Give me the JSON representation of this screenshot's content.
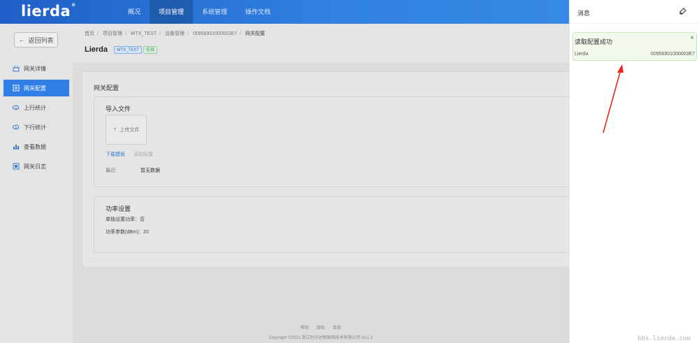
{
  "app": {
    "logo": "lierda"
  },
  "topnav": [
    "概况",
    "项目管理",
    "系统管理",
    "操作文档"
  ],
  "sidebar": {
    "back_label": "返回列表",
    "items": [
      {
        "label": "网关详情",
        "icon": "gateway-detail-icon"
      },
      {
        "label": "网关配置",
        "icon": "gateway-config-icon"
      },
      {
        "label": "上行统计",
        "icon": "upload-cloud-icon"
      },
      {
        "label": "下行统计",
        "icon": "download-cloud-icon"
      },
      {
        "label": "查看数据",
        "icon": "bar-chart-icon"
      },
      {
        "label": "网关日志",
        "icon": "log-icon"
      }
    ]
  },
  "breadcrumb": [
    "首页",
    "项目管理",
    "WTX_TEST",
    "设备管理",
    "00956901000003E7",
    "网关配置"
  ],
  "page": {
    "title": "Lierda",
    "tag_project": "WTX_TEST",
    "tag_status": "在线"
  },
  "config": {
    "card_title": "网关配置",
    "import_title": "导入文件",
    "upload_label": "上传文件",
    "download_template": "下载模板",
    "read_config": "读取配置",
    "recent_label": "最近:",
    "recent_value": "暂无数据",
    "power_title": "功率设置",
    "power_single": "单独设置功率：否",
    "power_param": "功率参数(dBm)：20"
  },
  "footer": {
    "links": [
      "帮助",
      "隐私",
      "条款"
    ],
    "copyright": "Copyright ©2021 浙江利尔达物联网技术有限公司 v3.1.2"
  },
  "messages": {
    "title": "消息",
    "toast_title": "读取配置成功",
    "toast_device": "Lierda",
    "toast_id": "00956901000003E7",
    "close": "×"
  },
  "watermark": "bbs.lierda.com",
  "colors": {
    "primary": "#2f7fe6",
    "success_bg": "#f0f9eb",
    "arrow": "#e8261a"
  }
}
